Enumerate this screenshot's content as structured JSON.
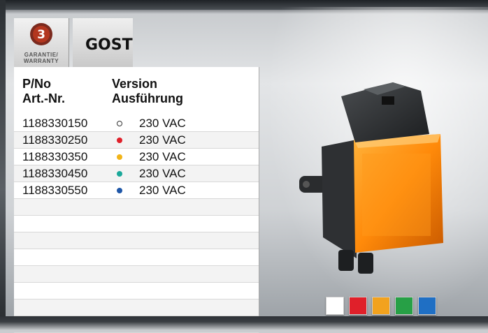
{
  "badges": {
    "warranty_number": "3",
    "warranty_line1": "GARANTIE/",
    "warranty_line2": "WARRANTY",
    "gost": "GOST"
  },
  "table": {
    "col1_line1": "P/No",
    "col1_line2": "Art.-Nr.",
    "col2_line1": "Version",
    "col2_line2": "Ausführung",
    "rows": [
      {
        "pn": "1188330150",
        "color": "#ffffff",
        "version": "230 VAC"
      },
      {
        "pn": "1188330250",
        "color": "#e0202a",
        "version": "230 VAC"
      },
      {
        "pn": "1188330350",
        "color": "#f2b418",
        "version": "230 VAC"
      },
      {
        "pn": "1188330450",
        "color": "#1aa89a",
        "version": "230 VAC"
      },
      {
        "pn": "1188330550",
        "color": "#1f57a8",
        "version": "230 VAC"
      }
    ]
  },
  "swatches": [
    "#ffffff",
    "#e0202a",
    "#f2a21e",
    "#27a046",
    "#1f6fc4"
  ]
}
